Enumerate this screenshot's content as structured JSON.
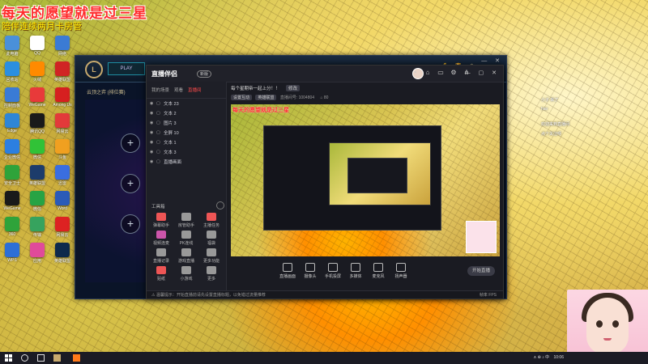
{
  "overlay": {
    "title": "每天的愿望就是过三星",
    "subtitle": "陪伴连续两月卡房管"
  },
  "desktop_icons": [
    {
      "label": "此电脑",
      "icon": "computer-icon",
      "color": "#4a90d9"
    },
    {
      "label": "QQ",
      "icon": "chat-icon",
      "color": "#ffffff"
    },
    {
      "label": "网络",
      "icon": "network-icon",
      "color": "#3b7bd4"
    },
    {
      "label": "回收站",
      "icon": "recycle-bin-icon",
      "color": "#2b8fe0"
    },
    {
      "label": "火绒",
      "icon": "shield-icon",
      "color": "#ff8a00"
    },
    {
      "label": "英雄联盟",
      "icon": "game-icon",
      "color": "#d02424"
    },
    {
      "label": "控制面板",
      "icon": "control-panel-icon",
      "color": "#3a7bd5"
    },
    {
      "label": "WeGame",
      "icon": "wegame-icon",
      "color": "#e83a3a"
    },
    {
      "label": "Among Us",
      "icon": "among-us-icon",
      "color": "#d62020"
    },
    {
      "label": "Edge",
      "icon": "edge-icon",
      "color": "#2f86d6"
    },
    {
      "label": "腾讯QQ",
      "icon": "penguin-icon",
      "color": "#1a1a1a"
    },
    {
      "label": "网易云",
      "icon": "music-icon",
      "color": "#e23a3a"
    },
    {
      "label": "企业微信",
      "icon": "wecom-icon",
      "color": "#2c7fe0"
    },
    {
      "label": "微信",
      "icon": "wechat-icon",
      "color": "#31c237"
    },
    {
      "label": "斗鱼",
      "icon": "douyu-icon",
      "color": "#f0a020"
    },
    {
      "label": "安全卫士",
      "icon": "security-icon",
      "color": "#2fa33a"
    },
    {
      "label": "英雄联盟",
      "icon": "lol-icon",
      "color": "#1d3c6b"
    },
    {
      "label": "迅雷",
      "icon": "thunder-icon",
      "color": "#3a6ee0"
    },
    {
      "label": "WeGame",
      "icon": "wegame-icon",
      "color": "#1a1a1a"
    },
    {
      "label": "微信",
      "icon": "wechat-icon",
      "color": "#27a344"
    },
    {
      "label": "Word",
      "icon": "word-icon",
      "color": "#2b5bb8"
    },
    {
      "label": "360",
      "icon": "s360-icon",
      "color": "#2fa33a"
    },
    {
      "label": "传输",
      "icon": "transfer-icon",
      "color": "#36a35e"
    },
    {
      "label": "网易云",
      "icon": "music-icon",
      "color": "#d22"
    },
    {
      "label": "WPS",
      "icon": "wps-icon",
      "color": "#2d6fd6"
    },
    {
      "label": "应用",
      "icon": "apps-icon",
      "color": "#e04a9a"
    },
    {
      "label": "英雄联盟",
      "icon": "lol-icon",
      "color": "#0d2a4c"
    }
  ],
  "lol_client": {
    "logo": "L",
    "play_label": "PLAY",
    "mode": "云顶之弈 (排位赛)",
    "status": [
      "💰",
      "🏆",
      "⚙"
    ]
  },
  "stream_app": {
    "app_name": "直播伴侣",
    "badge": "新版",
    "tabs": [
      "我的场景",
      "观看",
      "直播间"
    ],
    "active_tab": "直播间",
    "layers": [
      "文本 23",
      "文本 2",
      "图片 3",
      "全屏 10",
      "文本 1",
      "文本 3",
      "直播画面"
    ],
    "tools_title": "工具箱",
    "tools": [
      {
        "label": "弹幕助手",
        "color": "#e55"
      },
      {
        "label": "房管助手",
        "color": "#999"
      },
      {
        "label": "主播任务",
        "color": "#e55"
      },
      {
        "label": "视频连麦",
        "color": "#c5a"
      },
      {
        "label": "PK连线",
        "color": "#999"
      },
      {
        "label": "福袋",
        "color": "#999"
      },
      {
        "label": "直播记录",
        "color": "#999"
      },
      {
        "label": "游戏直播",
        "color": "#999"
      },
      {
        "label": "更多功能",
        "color": "#999"
      },
      {
        "label": "贴纸",
        "color": "#e55"
      },
      {
        "label": "小游戏",
        "color": "#999"
      },
      {
        "label": "更多",
        "color": "#999"
      }
    ],
    "stream_title": "每个星期帝一起上分！！",
    "title_badge": "修改",
    "sub_chips": [
      "设置互动",
      "英雄联盟"
    ],
    "sub_info": "直播间号: 1004804",
    "viewers": "80",
    "bottom_buttons": [
      "直播画面",
      "摄像头",
      "手机投屏",
      "多媒体",
      "麦克风",
      "扬声器"
    ],
    "live_button": "开始直播",
    "status_left": "⚠ 温馨提示：开始直播前请先设置直播标题，以免错过流量推荐",
    "status_right": "帧率 FPS"
  },
  "preview": {
    "title": "每天的愿望就是过三星"
  },
  "side_notes": [
    "小子 来了",
    "hao",
    "欢迎来到直播间",
    "点个关注呀"
  ],
  "taskbar": {
    "time": "10:06",
    "tray_icons": "∧ ⊕ ♪ 中"
  }
}
